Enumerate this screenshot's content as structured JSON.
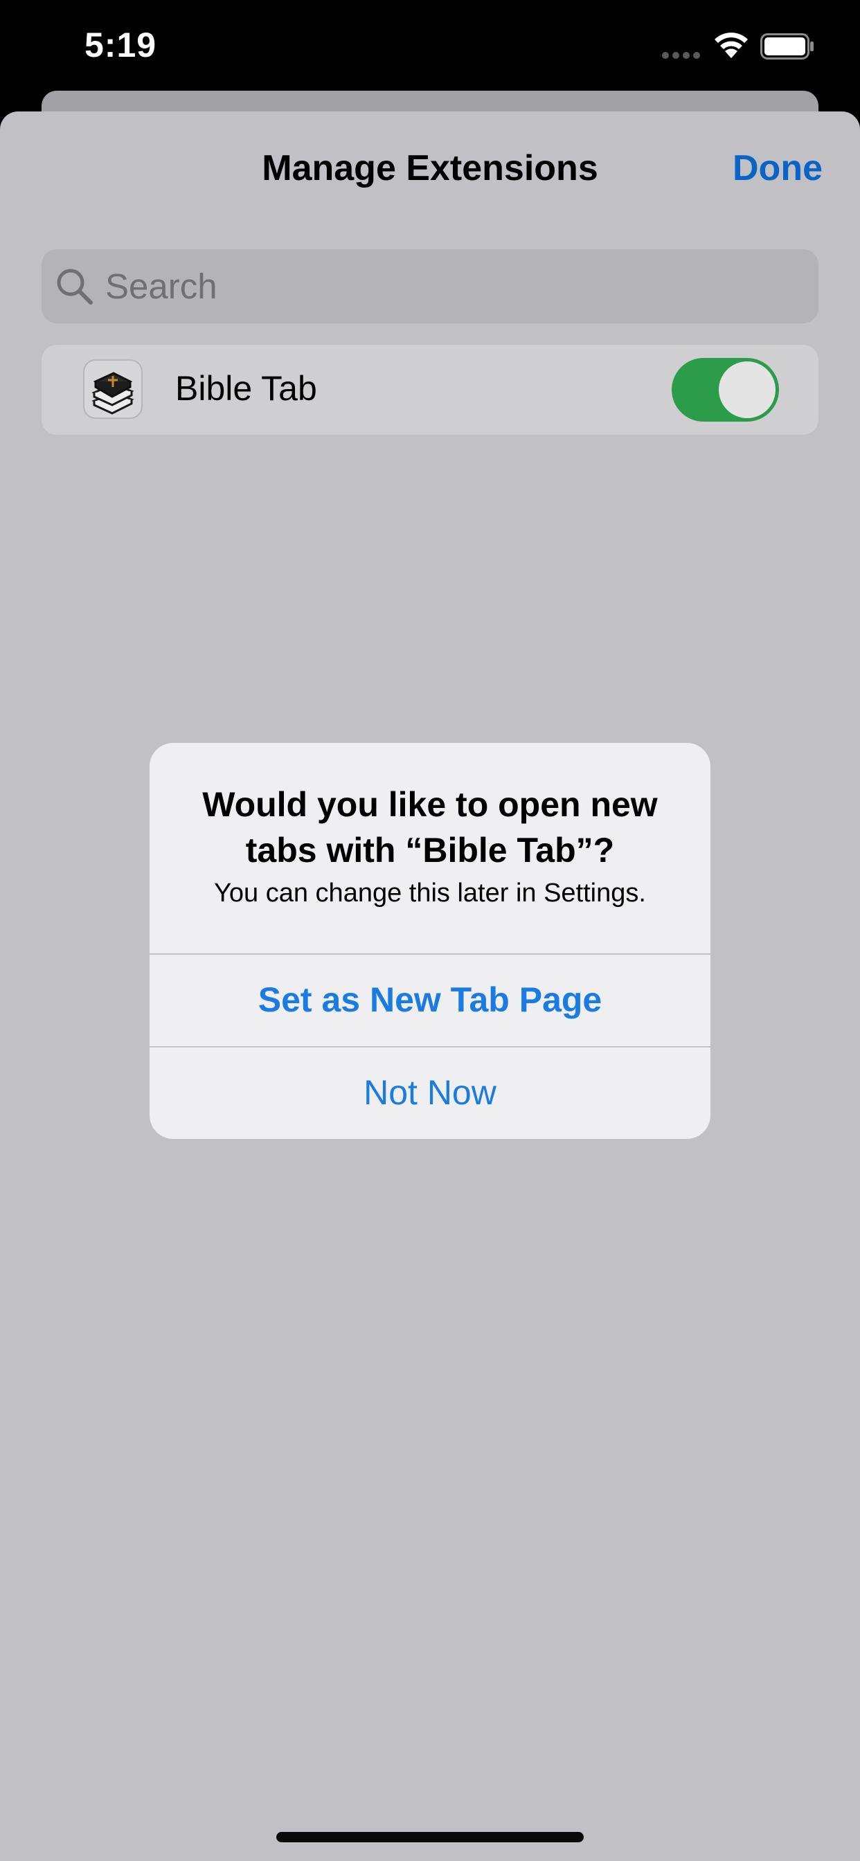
{
  "status_bar": {
    "time": "5:19",
    "icons": [
      "signal-icon",
      "wifi-icon",
      "battery-icon"
    ]
  },
  "sheet": {
    "title": "Manage Extensions",
    "done_label": "Done"
  },
  "search": {
    "placeholder": "Search",
    "value": ""
  },
  "extensions": [
    {
      "name": "Bible Tab",
      "icon": "bible-book-icon",
      "enabled": true
    }
  ],
  "alert": {
    "title": "Would you like to open new tabs with “Bible Tab”?",
    "message": "You can change this later in Settings.",
    "primary_button": "Set as New Tab Page",
    "secondary_button": "Not Now"
  },
  "colors": {
    "accent": "#1a7ce2",
    "toggle_on": "#2b9c49",
    "sheet_background": "#c1c1c5",
    "alert_background": "#efeff1"
  }
}
